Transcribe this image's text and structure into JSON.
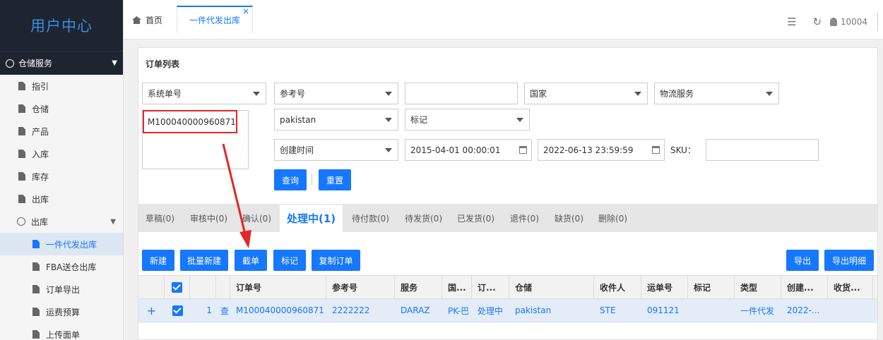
{
  "sidebar": {
    "brand": "用户中心",
    "group": "仓储服务",
    "items": [
      "指引",
      "仓储",
      "产品",
      "入库",
      "库存",
      "出库"
    ],
    "sub_group": "出库",
    "sub_items": [
      "一件代发出库",
      "FBA送仓出库",
      "订单导出",
      "运费预算",
      "上传面单"
    ]
  },
  "topbar": {
    "home_tab": "首页",
    "active_tab": "一件代发出库",
    "close": "×",
    "user": "10004"
  },
  "panel": {
    "title": "订单列表",
    "filters": {
      "sys_no": "系统单号",
      "ref_no": "参考号",
      "ref_value": "",
      "country": "国家",
      "logistics": "物流服务",
      "warehouse": "pakistan",
      "mark": "标记",
      "order_input": "M100040000960871",
      "time_type": "创建时间",
      "date_from": "2015-04-01 00:00:01",
      "date_to": "2022-06-13 23:59:59",
      "sku_label": "SKU："
    },
    "query_btn": "查询",
    "reset_btn": "重置"
  },
  "status_tabs": [
    "草稿(0)",
    "审核中(0)",
    "确认(0)",
    "处理中(1)",
    "待付款(0)",
    "待发货(0)",
    "已发货(0)",
    "退件(0)",
    "缺货(0)",
    "删除(0)"
  ],
  "actions": {
    "new": "新建",
    "batch_new": "批量新建",
    "intercept": "截单",
    "mark": "标记",
    "copy": "复制订单",
    "export": "导出",
    "export_detail": "导出明细"
  },
  "table": {
    "headers": [
      "订单号",
      "参考号",
      "服务",
      "国...",
      "订...",
      "仓储",
      "收件人",
      "运单号",
      "标记",
      "类型",
      "创建...",
      "收货..."
    ],
    "row": {
      "expand": "+",
      "index": "1",
      "view": "查",
      "order_no": "M100040000960871",
      "ref_no": "2222222",
      "service": "DARAZ",
      "country": "PK-巴",
      "status": "处理中",
      "warehouse": "pakistan",
      "recipient": "STE",
      "tracking": "091121",
      "mark": "",
      "type": "一件代发",
      "created": "2022-..."
    }
  }
}
